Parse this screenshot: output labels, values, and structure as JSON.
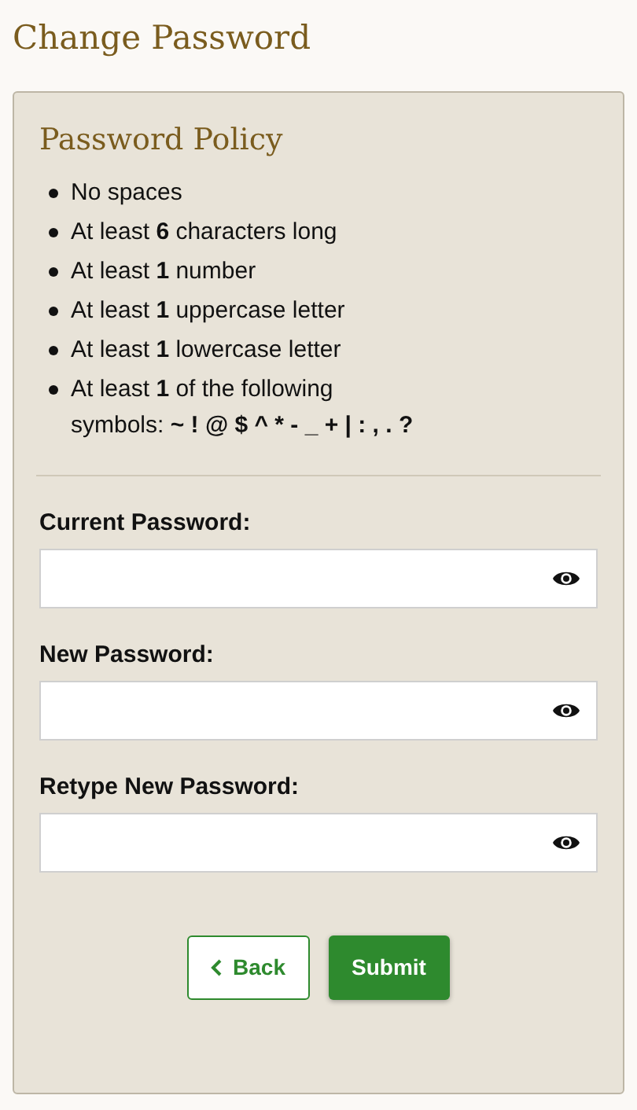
{
  "page_title": "Change Password",
  "policy": {
    "title": "Password Policy",
    "rules": [
      "No spaces",
      "At least **6** characters long",
      "At least **1** number",
      "At least **1** uppercase letter",
      "At least **1** lowercase letter",
      "At least **1** of the following symbols: **~ ! @ $ ^ * - _ + | : , . ?**"
    ]
  },
  "fields": [
    {
      "label": "Current Password:"
    },
    {
      "label": "New Password:"
    },
    {
      "label": "Retype New Password:"
    }
  ],
  "buttons": [
    {
      "kind": "back",
      "label": "Back"
    },
    {
      "kind": "submit",
      "label": "Submit"
    }
  ]
}
